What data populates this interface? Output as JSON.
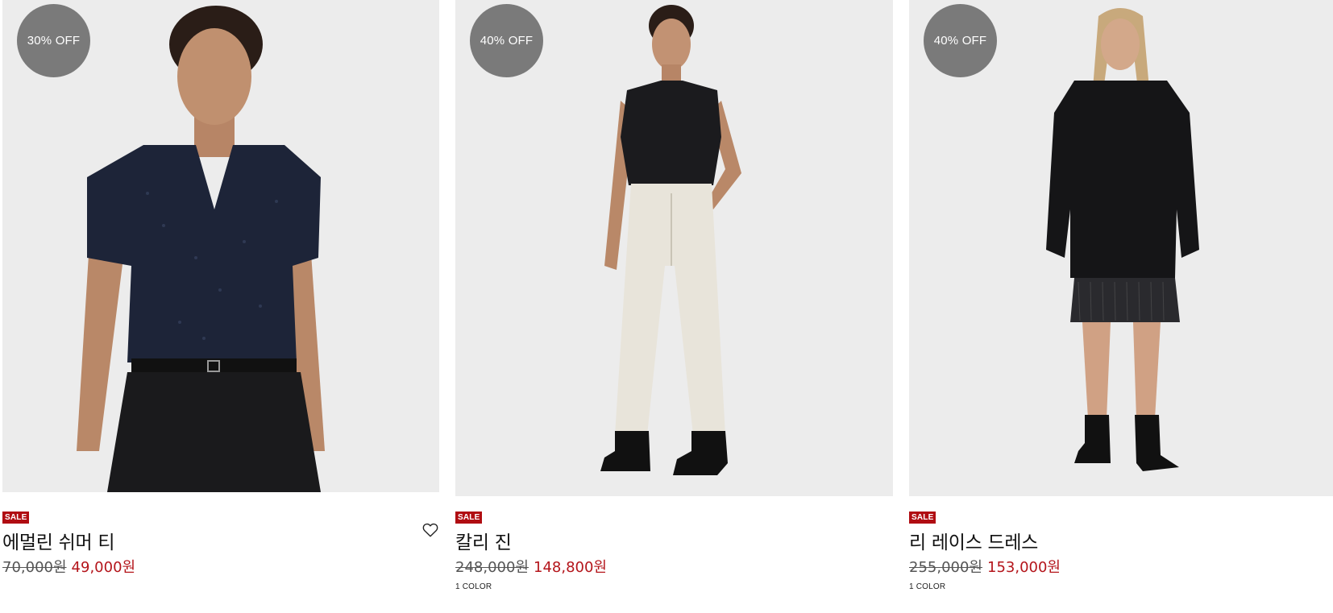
{
  "products": [
    {
      "discount_badge": "30% OFF",
      "sale_tag": "SALE",
      "name": "에멀린 쉬머 티",
      "original_price": "70,000원",
      "sale_price": "49,000원",
      "image_icon": "model-photo-navy-vneck-tee"
    },
    {
      "discount_badge": "40% OFF",
      "sale_tag": "SALE",
      "name": "칼리 진",
      "original_price": "248,000원",
      "sale_price": "148,800원",
      "colors": "1 COLOR",
      "image_icon": "model-photo-white-jeans"
    },
    {
      "discount_badge": "40% OFF",
      "sale_tag": "SALE",
      "name": "리 레이스 드레스",
      "original_price": "255,000원",
      "sale_price": "153,000원",
      "colors": "1 COLOR",
      "image_icon": "model-photo-black-lace-dress"
    }
  ],
  "wishlist_icon": "heart-outline-icon",
  "colors": {
    "badge_bg": "#7a7a7a",
    "sale_tag_bg": "#b00d12",
    "sale_price": "#b4151b",
    "image_bg": "#ebebeb"
  }
}
